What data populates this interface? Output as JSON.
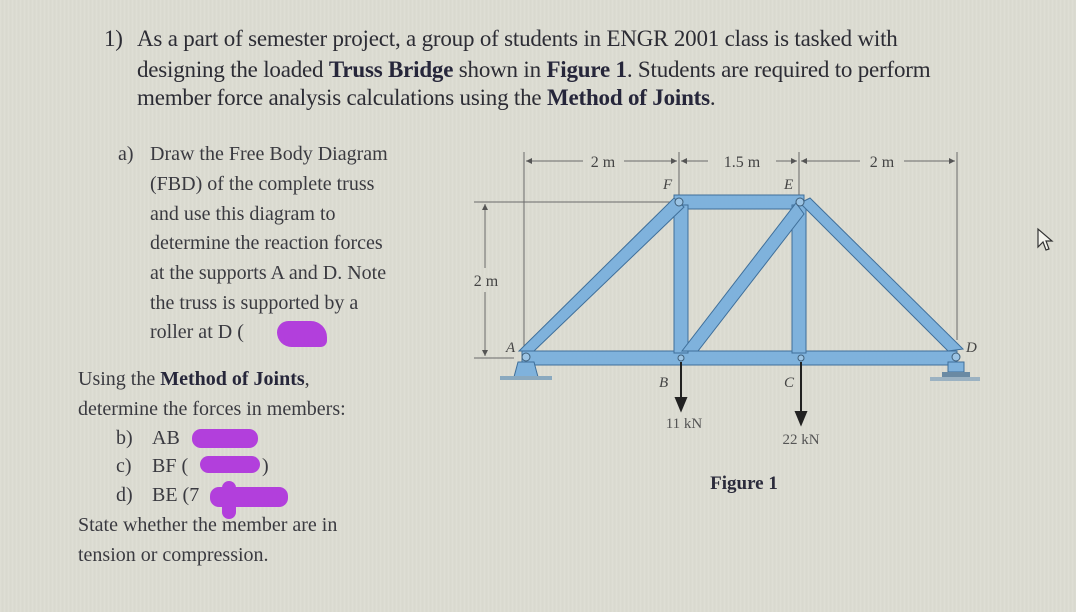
{
  "question": {
    "number": "1)",
    "lines": [
      [
        "As a part of semester project, a group of students in ENGR 2001 class is tasked with"
      ],
      [
        "designing the loaded ",
        "Truss Bridge",
        " shown in ",
        "Figure 1",
        ". Students are required to perform"
      ],
      [
        "member force analysis calculations using the ",
        "Method of Joints",
        "."
      ]
    ]
  },
  "part_a": {
    "label": "a)",
    "lines": [
      "Draw the Free Body Diagram",
      "(FBD) of the complete truss",
      "and use this diagram to",
      "determine the reaction forces",
      "at the supports A and D. Note",
      "the truss is supported by a",
      "roller at D ("
    ]
  },
  "method": {
    "line1_prefix": "Using the ",
    "line1_bold": "Method of Joints",
    "line1_suffix": ",",
    "line2": "determine the forces in members:"
  },
  "members": [
    {
      "label": "b)",
      "member": "AB"
    },
    {
      "label": "c)",
      "member": "BF ("
    },
    {
      "label": "d)",
      "member": "BE (7"
    }
  ],
  "closing": [
    "State whether the member are in",
    "tension or compression."
  ],
  "figure": {
    "caption": "Figure 1",
    "dimensions": {
      "AF_horizontal": "2 m",
      "FE_horizontal": "1.5 m",
      "ED_horizontal": "2 m",
      "height": "2 m"
    },
    "joints": [
      "A",
      "B",
      "C",
      "D",
      "E",
      "F"
    ],
    "loads": [
      {
        "joint": "B",
        "value": "11 kN"
      },
      {
        "joint": "C",
        "value": "22 kN"
      }
    ],
    "member_color": "#7fb2dc",
    "member_outline": "#3f6f9a"
  },
  "redaction_color": "#b23fdc"
}
